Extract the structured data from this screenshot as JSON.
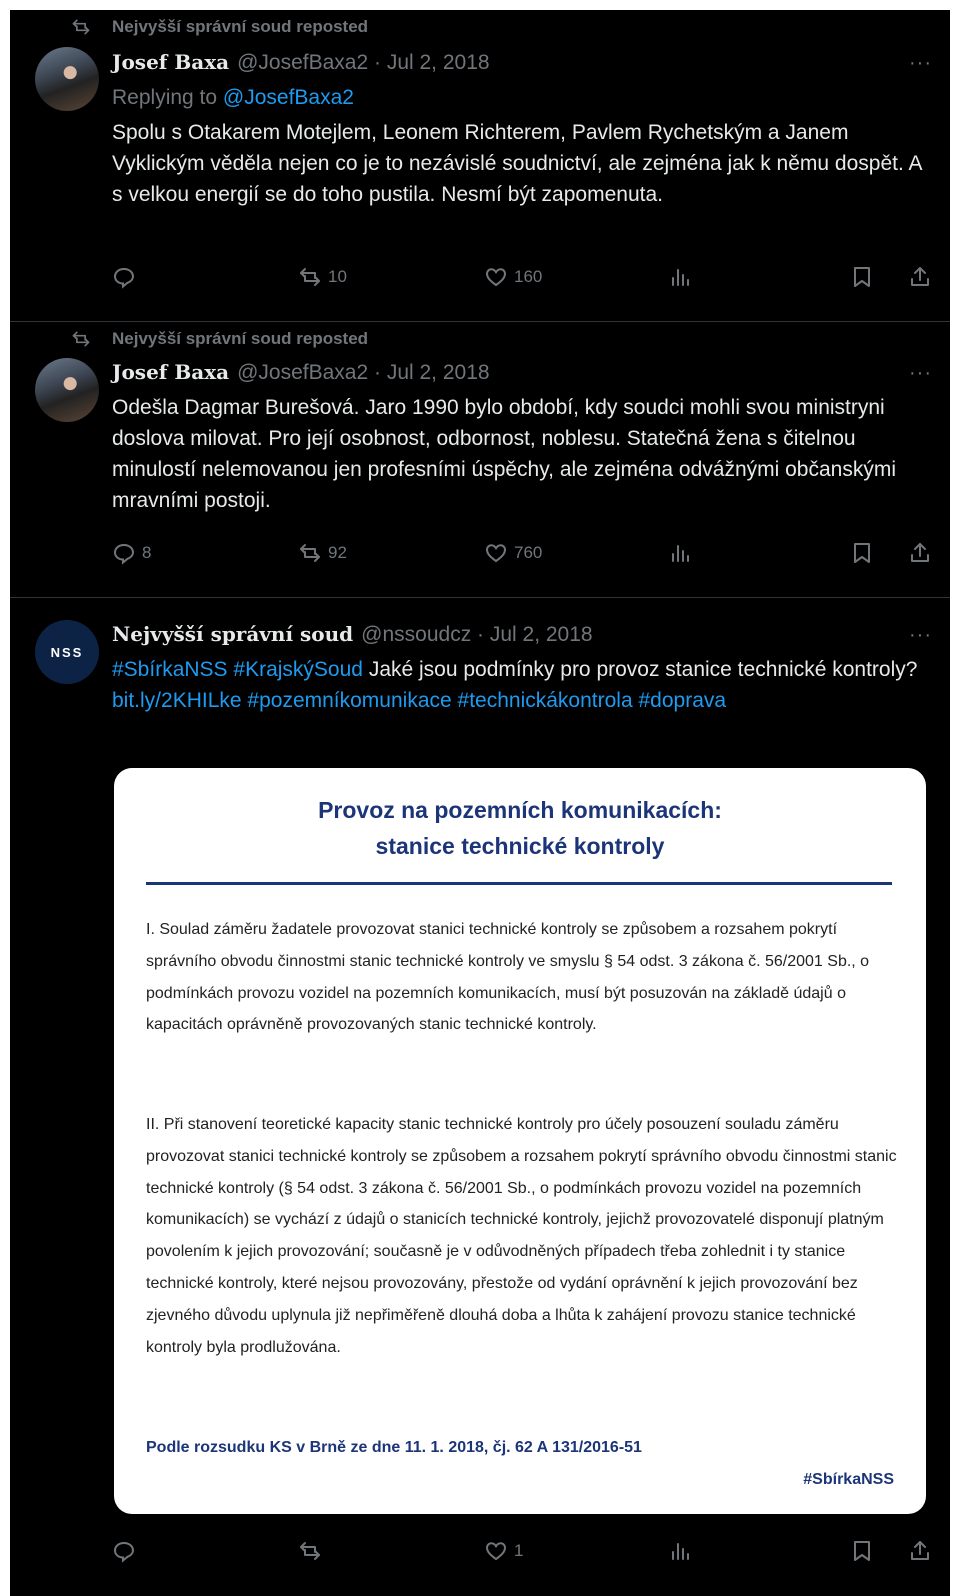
{
  "icons": {
    "repost": "repost-icon",
    "reply": "reply-icon",
    "retweet": "retweet-icon",
    "like": "heart-icon",
    "views": "views-icon",
    "bookmark": "bookmark-icon",
    "share": "share-icon",
    "more": "more-icon"
  },
  "colors": {
    "background": "#000000",
    "text": "#e7e9ea",
    "muted": "#71767b",
    "link": "#1d9bf0",
    "card_accent": "#1c3578"
  },
  "tweets": [
    {
      "repost_label": "Nejvyšší správní soud reposted",
      "name": "Josef Baxa",
      "handle_date": "@JosefBaxa2 · Jul 2, 2018",
      "more": "···",
      "replying_prefix": "Replying to",
      "replying_mention": "@JosefBaxa2",
      "text": "Spolu s Otakarem Motejlem, Leonem Richterem, Pavlem Rychetským a Janem Vyklickým věděla nejen co je to nezávislé soudnictví, ale zejména jak k němu dospět. A s velkou energií se do toho pustila. Nesmí být zapomenuta.",
      "reply_count": "",
      "retweet_count": "10",
      "like_count": "160"
    },
    {
      "repost_label": "Nejvyšší správní soud reposted",
      "name": "Josef Baxa",
      "handle_date": "@JosefBaxa2 · Jul 2, 2018",
      "more": "···",
      "text": "Odešla Dagmar Burešová. Jaro 1990 bylo období, kdy soudci mohli svou ministryni doslova milovat. Pro její osobnost, odbornost, noblesu. Statečná žena s čitelnou minulostí nelemovanou jen profesními úspěchy, ale zejména odvážnými občanskými mravními postoji.",
      "reply_count": "8",
      "retweet_count": "92",
      "like_count": "760"
    },
    {
      "avatar_text": "NSS",
      "name": "Nejvyšší správní soud",
      "handle_date": "@nssoudcz · Jul 2, 2018",
      "more": "···",
      "hashtag1": "#SbírkaNSS",
      "hashtag2": "#KrajskýSoud",
      "text_main": "Jaké jsou podmínky pro provoz stanice technické kontroly?",
      "link_url": "bit.ly/2KHILke",
      "hashtag3": "#pozemníkomunikace",
      "hashtag4": "#technickákontrola",
      "hashtag5": "#doprava",
      "reply_count": "",
      "retweet_count": "",
      "like_count": "1",
      "card": {
        "title_line1": "Provoz na pozemních komunikacích:",
        "title_line2": "stanice technické kontroly",
        "para1": "I. Soulad záměru žadatele provozovat stanici technické kontroly se způsobem a rozsahem pokrytí správního obvodu činnostmi stanic technické kontroly ve smyslu § 54 odst. 3 zákona č. 56/2001 Sb., o podmínkách provozu vozidel na pozemních komunikacích, musí být posuzován na základě údajů o kapacitách oprávněně provozovaných stanic technické kontroly.",
        "para2": "II. Při stanovení teoretické kapacity stanic technické kontroly pro účely posouzení souladu záměru provozovat stanici technické kontroly se způsobem a rozsahem pokrytí správního obvodu činnostmi stanic technické kontroly (§ 54 odst. 3 zákona č. 56/2001 Sb., o podmínkách provozu vozidel na pozemních komunikacích) se vychází z údajů o stanicích technické kontroly, jejichž provozovatelé disponují platným povolením k jejich provozování; současně je v odůvodněných případech třeba zohlednit i ty stanice technické kontroly, které nejsou provozovány, přestože od vydání oprávnění k jejich provozování bez zjevného důvodu uplynula již nepřiměřeně dlouhá doba a lhůta k zahájení provozu stanice technické kontroly byla prodlužována.",
        "source": "Podle rozsudku KS v Brně ze dne 11. 1. 2018, čj. 62 A 131/2016-51",
        "tag": "#SbírkaNSS"
      }
    }
  ]
}
